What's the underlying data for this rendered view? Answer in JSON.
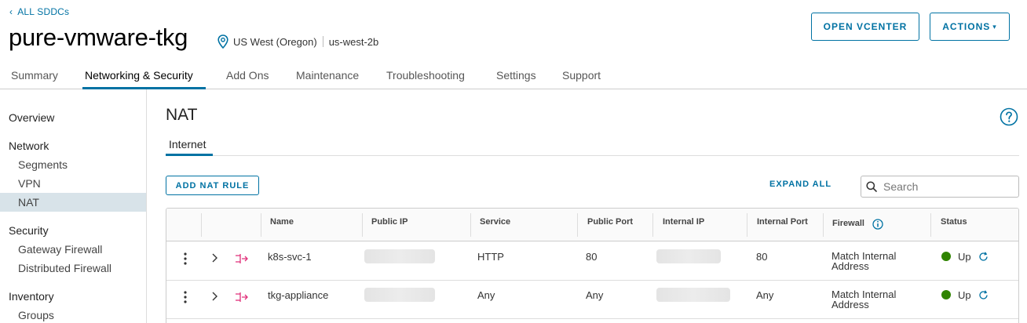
{
  "header": {
    "back_link": "ALL SDDCs",
    "title": "pure-vmware-tkg",
    "region": "US West (Oregon)",
    "zone": "us-west-2b",
    "open_vcenter": "OPEN VCENTER",
    "actions": "ACTIONS"
  },
  "tabs": [
    "Summary",
    "Networking & Security",
    "Add Ons",
    "Maintenance",
    "Troubleshooting",
    "Settings",
    "Support"
  ],
  "sidebar": {
    "overview": "Overview",
    "network": "Network",
    "segments": "Segments",
    "vpn": "VPN",
    "nat": "NAT",
    "security": "Security",
    "gateway_firewall": "Gateway Firewall",
    "distributed_firewall": "Distributed Firewall",
    "inventory": "Inventory",
    "groups": "Groups"
  },
  "main": {
    "title": "NAT",
    "subtab": "Internet",
    "add_rule": "ADD NAT RULE",
    "expand_all": "EXPAND ALL",
    "search_placeholder": "Search"
  },
  "table": {
    "columns": [
      "Name",
      "Public IP",
      "Service",
      "Public Port",
      "Internal IP",
      "Internal Port",
      "Firewall",
      "Status"
    ],
    "rows": [
      {
        "name": "k8s-svc-1",
        "service": "HTTP",
        "public_port": "80",
        "internal_port": "80",
        "firewall_line1": "Match Internal",
        "firewall_line2": "Address",
        "status": "Up"
      },
      {
        "name": "tkg-appliance",
        "service": "Any",
        "public_port": "Any",
        "internal_port": "Any",
        "firewall_line1": "Match Internal",
        "firewall_line2": "Address",
        "status": "Up"
      }
    ]
  },
  "colors": {
    "accent": "#0072a3",
    "status_up": "#2f8400",
    "nat_icon": "#e0307a"
  }
}
